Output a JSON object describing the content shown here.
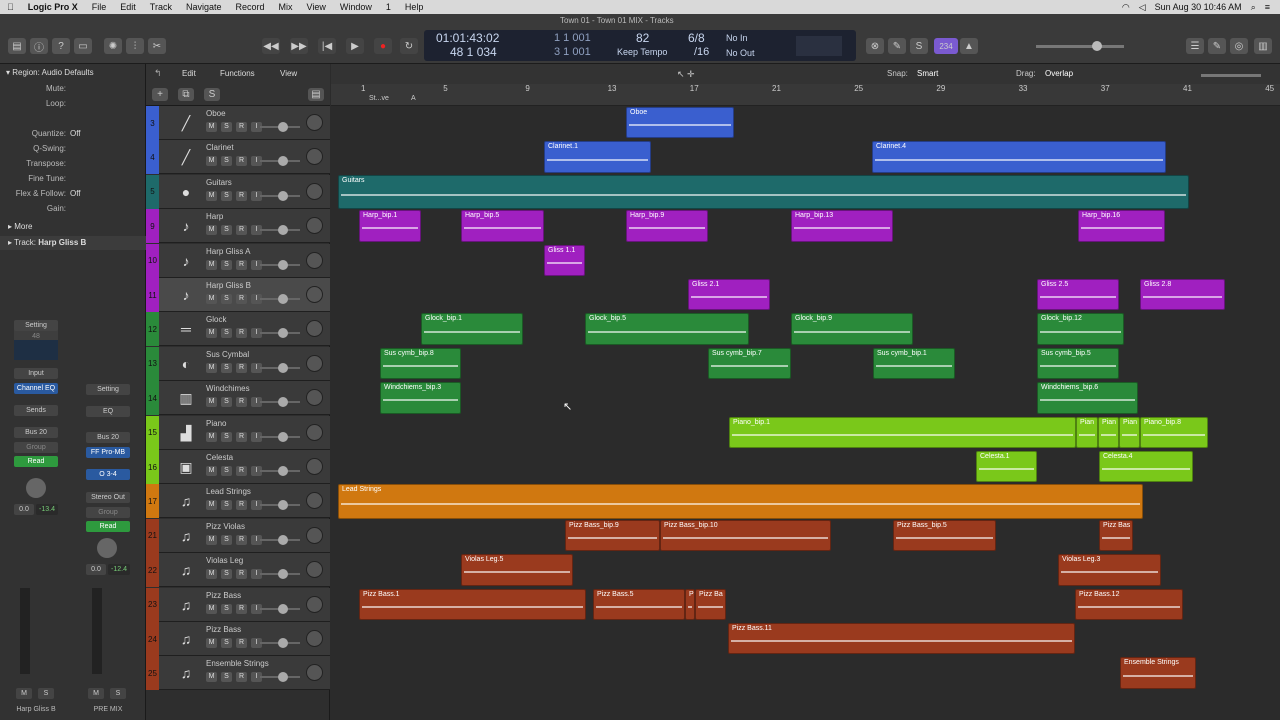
{
  "menubar": {
    "app": "Logic Pro X",
    "items": [
      "File",
      "Edit",
      "Track",
      "Navigate",
      "Record",
      "Mix",
      "View",
      "Window",
      "1",
      "Help"
    ],
    "clock": "Sun Aug 30  10:46 AM"
  },
  "window": {
    "title": "Town 01 - Town 01 MIX - Tracks"
  },
  "lcd": {
    "time": "01:01:43:02",
    "bars": "48  1  034",
    "pos1": "1  1  001",
    "pos2": "3  1  001",
    "tempo": "82",
    "tempo_label": "Keep Tempo",
    "sig": "6/8",
    "div": "/16",
    "in": "No In",
    "out": "No Out",
    "badge": "234"
  },
  "menu2": {
    "edit": "Edit",
    "functions": "Functions",
    "view": "View",
    "snap_label": "Snap:",
    "snap": "Smart",
    "drag_label": "Drag:",
    "drag": "Overlap"
  },
  "inspector": {
    "region_title": "Region: Audio Defaults",
    "rows": [
      [
        "Mute:",
        ""
      ],
      [
        "Loop:",
        ""
      ],
      [
        "",
        ""
      ],
      [
        "Quantize:",
        "Off"
      ],
      [
        "Q-Swing:",
        ""
      ],
      [
        "Transpose:",
        ""
      ],
      [
        "Fine Tune:",
        ""
      ],
      [
        "Flex & Follow:",
        "Off"
      ],
      [
        "Gain:",
        ""
      ]
    ],
    "more": "More",
    "track_label": "Track:",
    "track_name": "Harp Gliss B"
  },
  "strips": [
    {
      "setting": "Setting",
      "eq": "EQ",
      "input": "Input",
      "plugin": "Channel EQ",
      "sends": "Sends",
      "out": "Bus 20",
      "group": "Group",
      "mode": "Read",
      "vol": "0.0",
      "peak": "-13.4",
      "name": "Harp Gliss B",
      "m": "M",
      "s": "S",
      "knob_text": "48"
    },
    {
      "setting": "Setting",
      "eq": "EQ",
      "input": "Bus 20",
      "plugin": "FF Pro-MB",
      "sends": "O 3-4",
      "out": "Stereo Out",
      "group": "Group",
      "mode": "Read",
      "vol": "0.0",
      "peak": "-12.4",
      "name": "PRE MIX",
      "m": "M",
      "s": "S"
    }
  ],
  "colors": {
    "blue": "#3a5fcf",
    "teal": "#1e6a6a",
    "purple": "#a020c0",
    "green": "#2a8a3a",
    "lime": "#7ac81a",
    "orange": "#d07810",
    "brown": "#9a3a1e"
  },
  "ruler": {
    "ticks": [
      "1",
      "5",
      "9",
      "13",
      "17",
      "21",
      "25",
      "29",
      "33",
      "37",
      "41",
      "45"
    ],
    "markers": [
      "St...ve",
      "A"
    ]
  },
  "tracks": [
    {
      "num": "3",
      "name": "Oboe",
      "color": "#3a5fcf",
      "icon": "oboe-icon",
      "glyph": "╱"
    },
    {
      "num": "4",
      "name": "Clarinet",
      "color": "#3a5fcf",
      "icon": "clarinet-icon",
      "glyph": "╱"
    },
    {
      "num": "5",
      "name": "Guitars",
      "color": "#1e6a6a",
      "icon": "folder-icon",
      "glyph": "●"
    },
    {
      "num": "9",
      "name": "Harp",
      "color": "#a020c0",
      "icon": "harp-icon",
      "glyph": "♪"
    },
    {
      "num": "10",
      "name": "Harp Gliss A",
      "color": "#a020c0",
      "icon": "harp-icon",
      "glyph": "♪"
    },
    {
      "num": "11",
      "name": "Harp Gliss B",
      "color": "#a020c0",
      "icon": "harp-icon",
      "glyph": "♪"
    },
    {
      "num": "12",
      "name": "Glock",
      "color": "#2a8a3a",
      "icon": "glock-icon",
      "glyph": "═"
    },
    {
      "num": "13",
      "name": "Sus Cymbal",
      "color": "#2a8a3a",
      "icon": "cymbal-icon",
      "glyph": "◐"
    },
    {
      "num": "14",
      "name": "Windchimes",
      "color": "#2a8a3a",
      "icon": "windchimes-icon",
      "glyph": "▥"
    },
    {
      "num": "15",
      "name": "Piano",
      "color": "#7ac81a",
      "icon": "piano-icon",
      "glyph": "▟"
    },
    {
      "num": "16",
      "name": "Celesta",
      "color": "#7ac81a",
      "icon": "celesta-icon",
      "glyph": "▣"
    },
    {
      "num": "17",
      "name": "Lead Strings",
      "color": "#d07810",
      "icon": "violin-icon",
      "glyph": "♫"
    },
    {
      "num": "21",
      "name": "Pizz Violas",
      "color": "#9a3a1e",
      "icon": "violin-icon",
      "glyph": "♫"
    },
    {
      "num": "22",
      "name": "Violas Leg",
      "color": "#9a3a1e",
      "icon": "viola-icon",
      "glyph": "♫"
    },
    {
      "num": "23",
      "name": "Pizz Bass",
      "color": "#9a3a1e",
      "icon": "bass-icon",
      "glyph": "♫"
    },
    {
      "num": "24",
      "name": "Pizz Bass",
      "color": "#9a3a1e",
      "icon": "bass-icon",
      "glyph": "♫"
    },
    {
      "num": "25",
      "name": "Ensemble Strings",
      "color": "#9a3a1e",
      "icon": "ensemble-icon",
      "glyph": "♫"
    }
  ],
  "regions": [
    {
      "t": 0,
      "l": 295,
      "w": 108,
      "name": "Oboe",
      "c": "#3a5fcf"
    },
    {
      "t": 1,
      "l": 213,
      "w": 107,
      "name": "Clarinet.1",
      "c": "#3a5fcf"
    },
    {
      "t": 1,
      "l": 541,
      "w": 294,
      "name": "Clarinet.4",
      "c": "#3a5fcf"
    },
    {
      "t": 2,
      "l": 7,
      "w": 851,
      "name": "Guitars",
      "c": "#1e6a6a"
    },
    {
      "t": 3,
      "l": 28,
      "w": 62,
      "name": "Harp_bip.1",
      "c": "#a020c0"
    },
    {
      "t": 3,
      "l": 130,
      "w": 83,
      "name": "Harp_bip.5",
      "c": "#a020c0"
    },
    {
      "t": 3,
      "l": 295,
      "w": 82,
      "name": "Harp_bip.9",
      "c": "#a020c0"
    },
    {
      "t": 3,
      "l": 460,
      "w": 102,
      "name": "Harp_bip.13",
      "c": "#a020c0"
    },
    {
      "t": 3,
      "l": 747,
      "w": 87,
      "name": "Harp_bip.16",
      "c": "#a020c0"
    },
    {
      "t": 4,
      "l": 213,
      "w": 41,
      "name": "Gliss 1.1",
      "c": "#a020c0"
    },
    {
      "t": 5,
      "l": 357,
      "w": 82,
      "name": "Gliss 2.1",
      "c": "#a020c0"
    },
    {
      "t": 5,
      "l": 706,
      "w": 82,
      "name": "Gliss 2.5",
      "c": "#a020c0"
    },
    {
      "t": 5,
      "l": 809,
      "w": 85,
      "name": "Gliss 2.8",
      "c": "#a020c0"
    },
    {
      "t": 6,
      "l": 90,
      "w": 102,
      "name": "Glock_bip.1",
      "c": "#2a8a3a"
    },
    {
      "t": 6,
      "l": 254,
      "w": 164,
      "name": "Glock_bip.5",
      "c": "#2a8a3a"
    },
    {
      "t": 6,
      "l": 460,
      "w": 122,
      "name": "Glock_bip.9",
      "c": "#2a8a3a"
    },
    {
      "t": 6,
      "l": 706,
      "w": 87,
      "name": "Glock_bip.12",
      "c": "#2a8a3a"
    },
    {
      "t": 7,
      "l": 49,
      "w": 81,
      "name": "Sus cymb_bip.8",
      "c": "#2a8a3a"
    },
    {
      "t": 7,
      "l": 377,
      "w": 83,
      "name": "Sus cymb_bip.7",
      "c": "#2a8a3a"
    },
    {
      "t": 7,
      "l": 542,
      "w": 82,
      "name": "Sus cymb_bip.1",
      "c": "#2a8a3a"
    },
    {
      "t": 7,
      "l": 706,
      "w": 82,
      "name": "Sus cymb_bip.5",
      "c": "#2a8a3a"
    },
    {
      "t": 8,
      "l": 49,
      "w": 81,
      "name": "Windchiems_bip.3",
      "c": "#2a8a3a"
    },
    {
      "t": 8,
      "l": 706,
      "w": 101,
      "name": "Windchiems_bip.6",
      "c": "#2a8a3a"
    },
    {
      "t": 9,
      "l": 398,
      "w": 347,
      "name": "Piano_bip.1",
      "c": "#7ac81a"
    },
    {
      "t": 9,
      "l": 745,
      "w": 22,
      "name": "Pian",
      "c": "#7ac81a"
    },
    {
      "t": 9,
      "l": 767,
      "w": 21,
      "name": "Pian",
      "c": "#7ac81a"
    },
    {
      "t": 9,
      "l": 788,
      "w": 21,
      "name": "Pian",
      "c": "#7ac81a"
    },
    {
      "t": 9,
      "l": 809,
      "w": 68,
      "name": "Piano_bip.8",
      "c": "#7ac81a"
    },
    {
      "t": 10,
      "l": 645,
      "w": 61,
      "name": "Celesta.1",
      "c": "#7ac81a"
    },
    {
      "t": 10,
      "l": 768,
      "w": 94,
      "name": "Celesta.4",
      "c": "#7ac81a"
    },
    {
      "t": 11,
      "l": 7,
      "w": 805,
      "name": "Lead Strings",
      "c": "#d07810"
    },
    {
      "t": 12,
      "l": 234,
      "w": 95,
      "name": "Pizz Bass_bip.9",
      "c": "#9a3a1e"
    },
    {
      "t": 12,
      "l": 329,
      "w": 171,
      "name": "Pizz Bass_bip.10",
      "c": "#9a3a1e"
    },
    {
      "t": 12,
      "l": 562,
      "w": 103,
      "name": "Pizz Bass_bip.5",
      "c": "#9a3a1e"
    },
    {
      "t": 12,
      "l": 768,
      "w": 34,
      "name": "Pizz Bas",
      "c": "#9a3a1e"
    },
    {
      "t": 13,
      "l": 130,
      "w": 112,
      "name": "Violas Leg.5",
      "c": "#9a3a1e"
    },
    {
      "t": 13,
      "l": 727,
      "w": 103,
      "name": "Violas Leg.3",
      "c": "#9a3a1e"
    },
    {
      "t": 14,
      "l": 28,
      "w": 227,
      "name": "Pizz Bass.1",
      "c": "#9a3a1e"
    },
    {
      "t": 14,
      "l": 262,
      "w": 92,
      "name": "Pizz Bass.5",
      "c": "#9a3a1e"
    },
    {
      "t": 14,
      "l": 354,
      "w": 10,
      "name": "Pi",
      "c": "#9a3a1e"
    },
    {
      "t": 14,
      "l": 364,
      "w": 31,
      "name": "Pizz Ba",
      "c": "#9a3a1e"
    },
    {
      "t": 14,
      "l": 744,
      "w": 108,
      "name": "Pizz Bass.12",
      "c": "#9a3a1e"
    },
    {
      "t": 15,
      "l": 397,
      "w": 347,
      "name": "Pizz Bass.11",
      "c": "#9a3a1e"
    },
    {
      "t": 16,
      "l": 789,
      "w": 76,
      "name": "Ensemble Strings",
      "c": "#9a3a1e"
    }
  ]
}
